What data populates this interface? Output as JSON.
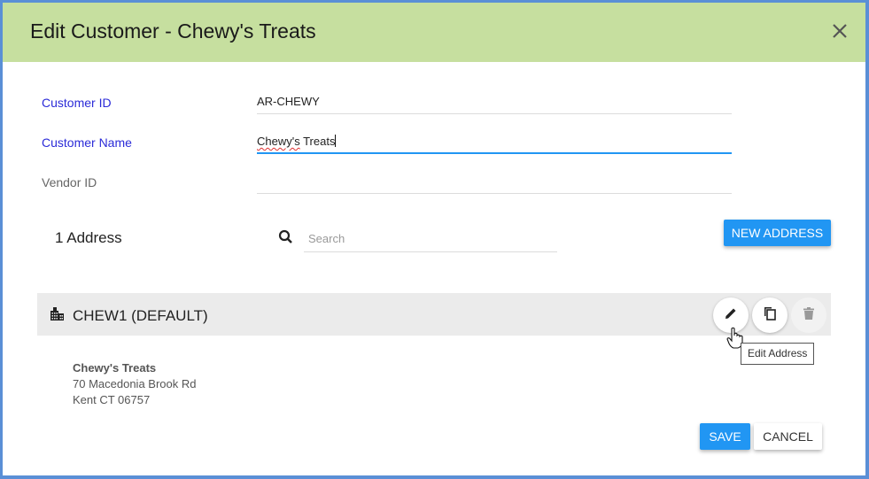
{
  "dialog": {
    "title": "Edit Customer - Chewy's Treats",
    "header_color": "#c6df9f",
    "close_icon": "close-icon"
  },
  "form": {
    "customer_id": {
      "label": "Customer ID",
      "value": "AR-CHEWY"
    },
    "customer_name": {
      "label": "Customer Name",
      "value_word1": "Chewy's",
      "value_word2": " Treats"
    },
    "vendor_id": {
      "label": "Vendor ID",
      "value": ""
    }
  },
  "addresses": {
    "count_label": "1 Address",
    "search_placeholder": "Search",
    "new_address_label": "NEW ADDRESS",
    "items": [
      {
        "code": "CHEW1 (DEFAULT)",
        "name": "Chewy's Treats",
        "street": "70 Macedonia Brook Rd",
        "city_line": "Kent CT 06757",
        "actions": [
          "edit-icon",
          "copy-icon",
          "delete-icon"
        ]
      }
    ],
    "tooltip": "Edit Address"
  },
  "footer": {
    "save_label": "SAVE",
    "cancel_label": "CANCEL"
  },
  "colors": {
    "accent": "#2196f3",
    "label_blue": "#2b2bd8",
    "frame": "#5a8fd6"
  }
}
